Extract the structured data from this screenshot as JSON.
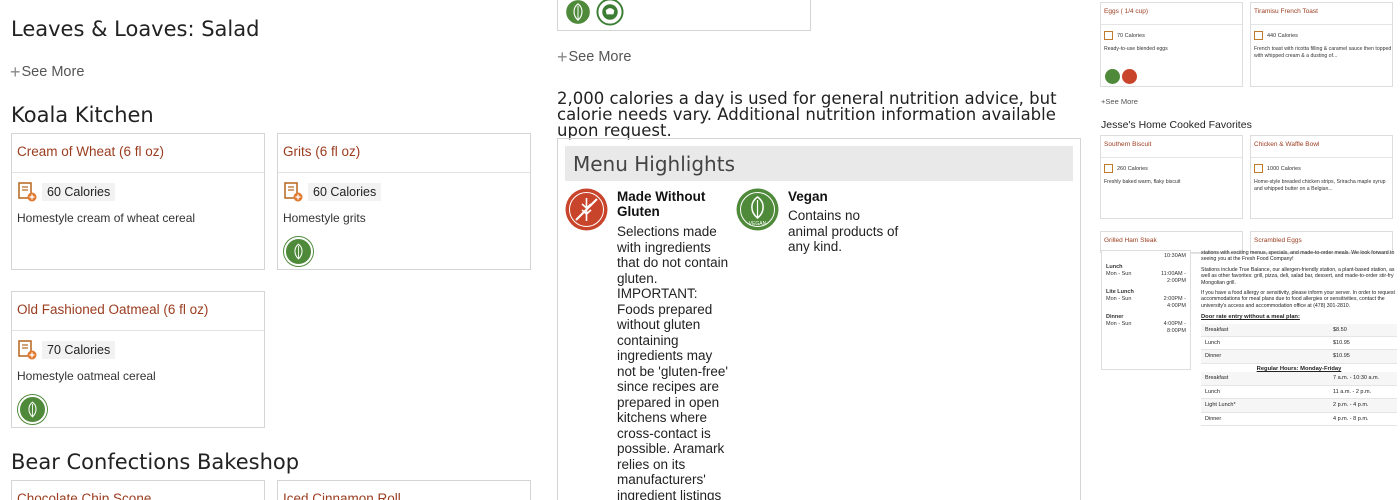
{
  "col1": {
    "leaves_title": "Leaves & Loaves: Salad",
    "see_more": "See More",
    "koala_title": "Koala Kitchen",
    "bear_title": "Bear Confections Bakeshop",
    "cards": [
      {
        "name": "Cream of Wheat (6 fl oz)",
        "calories": "60 Calories",
        "desc": "Homestyle cream of wheat cereal"
      },
      {
        "name": "Grits (6 fl oz)",
        "calories": "60 Calories",
        "desc": "Homestyle grits"
      },
      {
        "name": "Old Fashioned Oatmeal (6 fl oz)",
        "calories": "70 Calories",
        "desc": "Homestyle oatmeal cereal"
      },
      {
        "name": "Chocolate Chip Scone",
        "calories": "",
        "desc": ""
      },
      {
        "name": "Iced Cinnamon Roll",
        "calories": "",
        "desc": ""
      }
    ]
  },
  "col2": {
    "see_more": "See More",
    "calorie_note": "2,000 calories a day is used for general nutrition advice, but calorie needs vary. Additional nutrition information available upon request.",
    "highlights_title": "Menu Highlights",
    "gluten": {
      "title": "Made Without Gluten",
      "text": "Selections made with ingredients that do not contain gluten. IMPORTANT: Foods prepared without gluten containing ingredients may not be 'gluten-free' since recipes are prepared in open kitchens where cross-contact is possible. Aramark relies on its manufacturers' ingredient listings in determining"
    },
    "vegan": {
      "title": "Vegan",
      "text": "Contains no animal products of any kind.",
      "badge": "VEGAN"
    }
  },
  "col3": {
    "cards_top": [
      {
        "name": "Eggs ( 1/4 cup)",
        "calories": "70 Calories",
        "desc": "Ready-to-use blended eggs"
      },
      {
        "name": "Tiramisu French Toast",
        "calories": "440 Calories",
        "desc": "French toast with ricotta filling & caramel sauce then topped with whipped cream & a dusting of..."
      }
    ],
    "see_more": "See More",
    "section_title": "Jesse's Home Cooked Favorites",
    "cards_mid": [
      {
        "name": "Southern Biscuit",
        "calories": "260 Calories",
        "desc": "Freshly baked warm, flaky biscuit"
      },
      {
        "name": "Chicken & Waffle Bowl",
        "calories": "1000 Calories",
        "desc": "Home-style breaded chicken strips, Sriracha maple syrup and whipped butter on a Belgian..."
      }
    ],
    "cards_bottom": [
      {
        "name": "Grilled Ham Steak"
      },
      {
        "name": "Scrambled Eggs"
      }
    ],
    "hours": [
      {
        "label": "Lunch",
        "days": "Mon - Sun",
        "time": "11:00AM - 2:00PM"
      },
      {
        "label": "Lite Lunch",
        "days": "Mon - Sun",
        "time": "2:00PM - 4:00PM"
      },
      {
        "label": "Dinner",
        "days": "Mon - Sun",
        "time": "4:00PM - 8:00PM"
      }
    ],
    "hours_top": "10:30AM",
    "info_p1": "stations with exciting menus, specials, and made-to-order meals. We look forward to seeing you at the Fresh Food Company!",
    "info_p2": "Stations include True Balance, our allergen-friendly station, a plant-based station, as well as other favorites: grill, pizza, deli, salad bar, dessert, and made-to-order stir-fry Mongolian grill.",
    "info_p3": "If you have a food allergy or sensitivity, please inform your server. In order to request accommodations for meal plans due to food allergies or sensitivities, contact the university's access and accommodation office at (478) 301-2810.",
    "door_rate_title": "Door rate entry without a meal plan:",
    "rates": [
      {
        "meal": "Breakfast",
        "price": "$8.50"
      },
      {
        "meal": "Lunch",
        "price": "$10.95"
      },
      {
        "meal": "Dinner",
        "price": "$10.95"
      }
    ],
    "regular_hours_title": "Regular Hours: Monday-Friday",
    "regular_hours": [
      {
        "meal": "Breakfast",
        "time": "7 a.m. - 10:30 a.m."
      },
      {
        "meal": "Lunch",
        "time": "11 a.m. - 2 p.m."
      },
      {
        "meal": "Light Lunch*",
        "time": "2 p.m. - 4 p.m."
      },
      {
        "meal": "Dinner",
        "time": "4 p.m. - 8 p.m."
      }
    ]
  },
  "colors": {
    "accent": "#9b3c1f",
    "vegan_green": "#4f8a3a",
    "gluten_red": "#c8452c"
  }
}
